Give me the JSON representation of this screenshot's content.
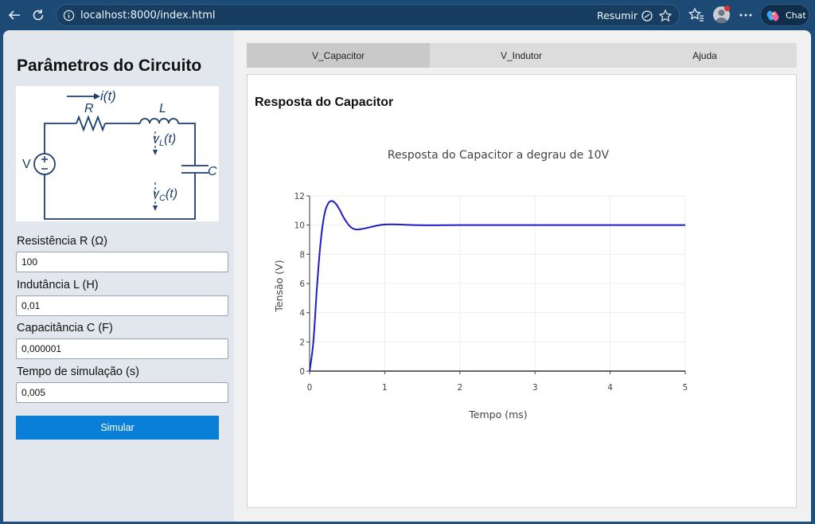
{
  "browser": {
    "url": "localhost:8000/index.html",
    "summarize_label": "Resumir",
    "chat_label": "Chat"
  },
  "sidebar": {
    "title": "Parâmetros do Circuito",
    "circuit": {
      "current_label": "i(t)",
      "resistor_label": "R",
      "inductor_label": "L",
      "source_label": "V",
      "capacitor_label": "C",
      "vl_label": "v",
      "vl_sub": "L",
      "vl_suffix": "(t)",
      "vc_label": "v",
      "vc_sub": "C",
      "vc_suffix": "(t)"
    },
    "fields": [
      {
        "label": "Resistência R (Ω)",
        "value": "100"
      },
      {
        "label": "Indutância L (H)",
        "value": "0,01"
      },
      {
        "label": "Capacitância C (F)",
        "value": "0,000001"
      },
      {
        "label": "Tempo de simulação (s)",
        "value": "0,005"
      }
    ],
    "simulate_label": "Simular"
  },
  "tabs": [
    {
      "label": "V_Capacitor",
      "active": true
    },
    {
      "label": "V_Indutor",
      "active": false
    },
    {
      "label": "Ajuda",
      "active": false
    }
  ],
  "panel": {
    "title": "Resposta do Capacitor"
  },
  "chart_data": {
    "type": "line",
    "title": "Resposta do Capacitor a degrau de 10V",
    "xlabel": "Tempo (ms)",
    "ylabel": "Tensão (V)",
    "xlim": [
      0,
      5
    ],
    "ylim": [
      0,
      12
    ],
    "xticks": [
      0,
      1,
      2,
      3,
      4,
      5
    ],
    "yticks": [
      0,
      2,
      4,
      6,
      8,
      10,
      12
    ],
    "grid": true,
    "line_color": "#1c1cc8",
    "series": [
      {
        "x": [
          0,
          0.05,
          0.1,
          0.15,
          0.2,
          0.25,
          0.3,
          0.35,
          0.4,
          0.45,
          0.5,
          0.55,
          0.6,
          0.65,
          0.7,
          0.8,
          0.9,
          1.0,
          1.1,
          1.2,
          1.4,
          1.6,
          2.0,
          3.0,
          4.0,
          5.0
        ],
        "y": [
          0,
          2.0,
          5.9,
          9.0,
          10.8,
          11.5,
          11.65,
          11.45,
          11.05,
          10.55,
          10.15,
          9.85,
          9.72,
          9.7,
          9.74,
          9.85,
          9.97,
          10.04,
          10.05,
          10.04,
          10.0,
          9.99,
          10.0,
          10.0,
          10.0,
          10.0
        ]
      }
    ]
  }
}
